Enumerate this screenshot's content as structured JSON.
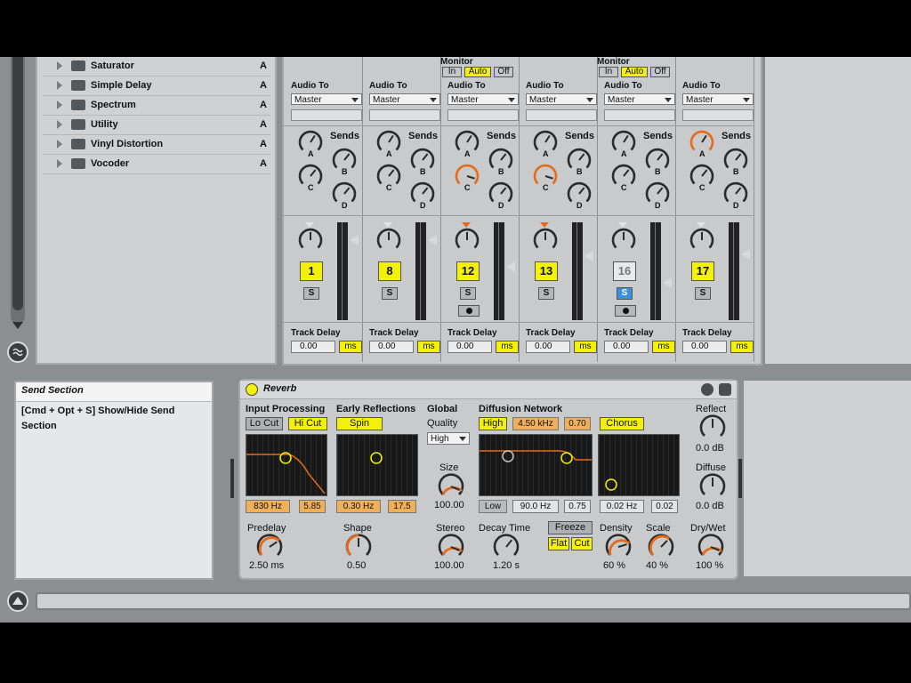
{
  "browser": {
    "items": [
      {
        "label": "Saturator",
        "tag": "A"
      },
      {
        "label": "Simple Delay",
        "tag": "A"
      },
      {
        "label": "Spectrum",
        "tag": "A"
      },
      {
        "label": "Utility",
        "tag": "A"
      },
      {
        "label": "Vinyl Distortion",
        "tag": "A"
      },
      {
        "label": "Vocoder",
        "tag": "A"
      }
    ]
  },
  "mixer": {
    "audio_to_label": "Audio To",
    "audio_to_value": "Master",
    "sends_label": "Sends",
    "monitor_label": "Monitor",
    "monitor_in": "In",
    "monitor_auto": "Auto",
    "monitor_off": "Off",
    "knob_a": "A",
    "knob_b": "B",
    "knob_c": "C",
    "knob_d": "D",
    "solo_label": "S",
    "track_delay_label": "Track Delay",
    "track_delay_value": "0.00",
    "track_delay_unit": "ms",
    "tracks": [
      {
        "number": "1"
      },
      {
        "number": "8"
      },
      {
        "number": "12"
      },
      {
        "number": "13"
      },
      {
        "number": "16"
      },
      {
        "number": "17"
      }
    ]
  },
  "info": {
    "title": "Send Section",
    "text1": "[Cmd + Opt + S] Show/Hide Send",
    "text2": "Section"
  },
  "reverb": {
    "title": "Reverb",
    "input_processing": "Input Processing",
    "lo_cut": "Lo Cut",
    "hi_cut": "Hi Cut",
    "in_freq": "830 Hz",
    "in_q": "5.85",
    "early_reflections": "Early Reflections",
    "spin": "Spin",
    "er_freq": "0.30 Hz",
    "er_amt": "17.5",
    "global": "Global",
    "quality": "Quality",
    "quality_value": "High",
    "size": "Size",
    "size_value": "100.00",
    "diffusion_network": "Diffusion Network",
    "dn_high": "High",
    "dn_freq": "4.50 kHz",
    "dn_amt": "0.70",
    "dn_low": "Low",
    "dn_low_freq": "90.0 Hz",
    "dn_low_amt": "0.75",
    "chorus": "Chorus",
    "chorus_freq": "0.02 Hz",
    "chorus_amt": "0.02",
    "reflect": "Reflect",
    "reflect_value": "0.0 dB",
    "diffuse": "Diffuse",
    "diffuse_value": "0.0 dB",
    "predelay": "Predelay",
    "predelay_value": "2.50 ms",
    "shape": "Shape",
    "shape_value": "0.50",
    "stereo": "Stereo",
    "stereo_value": "100.00",
    "decay_time": "Decay Time",
    "decay_value": "1.20 s",
    "freeze": "Freeze",
    "flat": "Flat",
    "cut": "Cut",
    "density": "Density",
    "density_value": "60 %",
    "scale": "Scale",
    "scale_value": "40 %",
    "dry_wet": "Dry/Wet",
    "dry_wet_value": "100 %"
  },
  "colors": {
    "accent_yellow": "#f3f10a",
    "accent_orange": "#e56a1a",
    "solo_blue": "#3a8fe0"
  }
}
